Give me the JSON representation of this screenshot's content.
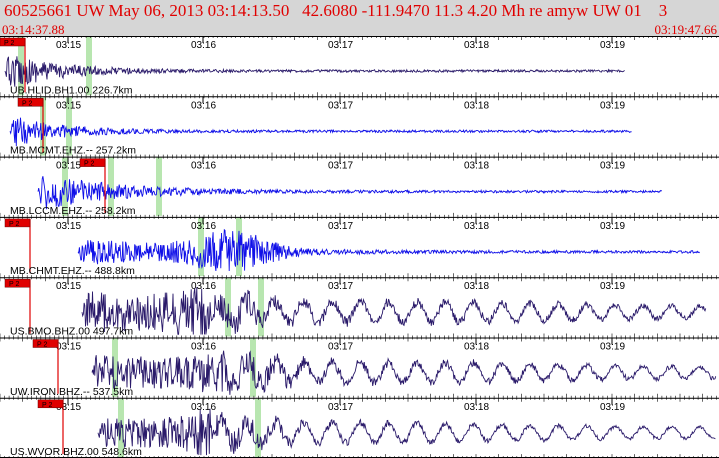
{
  "header": {
    "title": "60525661 UW May 06, 2013 03:14:13.50   42.6080 -111.9470 11.3 4.20 Mh re amyw UW 01    3",
    "start_time": "03:14:37.88",
    "end_time": "03:19:47.66"
  },
  "time_labels": [
    "03:15",
    "03:16",
    "03:17",
    "03:18",
    "03:19"
  ],
  "pick_label": "P 2",
  "colors": {
    "header_bg": "#d6d6d6",
    "header_text": "#e00000",
    "trace_blue": "#1010e8",
    "trace_navy": "#2a1a6a",
    "pick_red": "#e00000",
    "window_green": "#b8e6b0"
  },
  "traces": [
    {
      "station": "UB.HLID.BH1.00 226.7km",
      "pick_label": "P 2",
      "color": "navy"
    },
    {
      "station": "MB.MCMT.EHZ.-- 257.2km",
      "pick_label": "P 2",
      "color": "blue"
    },
    {
      "station": "MB.LCCM.EHZ.-- 258.2km",
      "pick_label": "P 2",
      "color": "blue"
    },
    {
      "station": "MB.CHMT.EHZ.-- 488.8km",
      "pick_label": "P 2",
      "color": "blue"
    },
    {
      "station": "US.BMO.BHZ.00 497.7km",
      "pick_label": "P 2",
      "color": "navy"
    },
    {
      "station": "UW.IRON.BHZ.-- 537.5km",
      "pick_label": "P 2",
      "color": "navy"
    },
    {
      "station": "US.WVOR.BHZ.00 548.6km",
      "pick_label": "P 2",
      "color": "navy"
    }
  ]
}
